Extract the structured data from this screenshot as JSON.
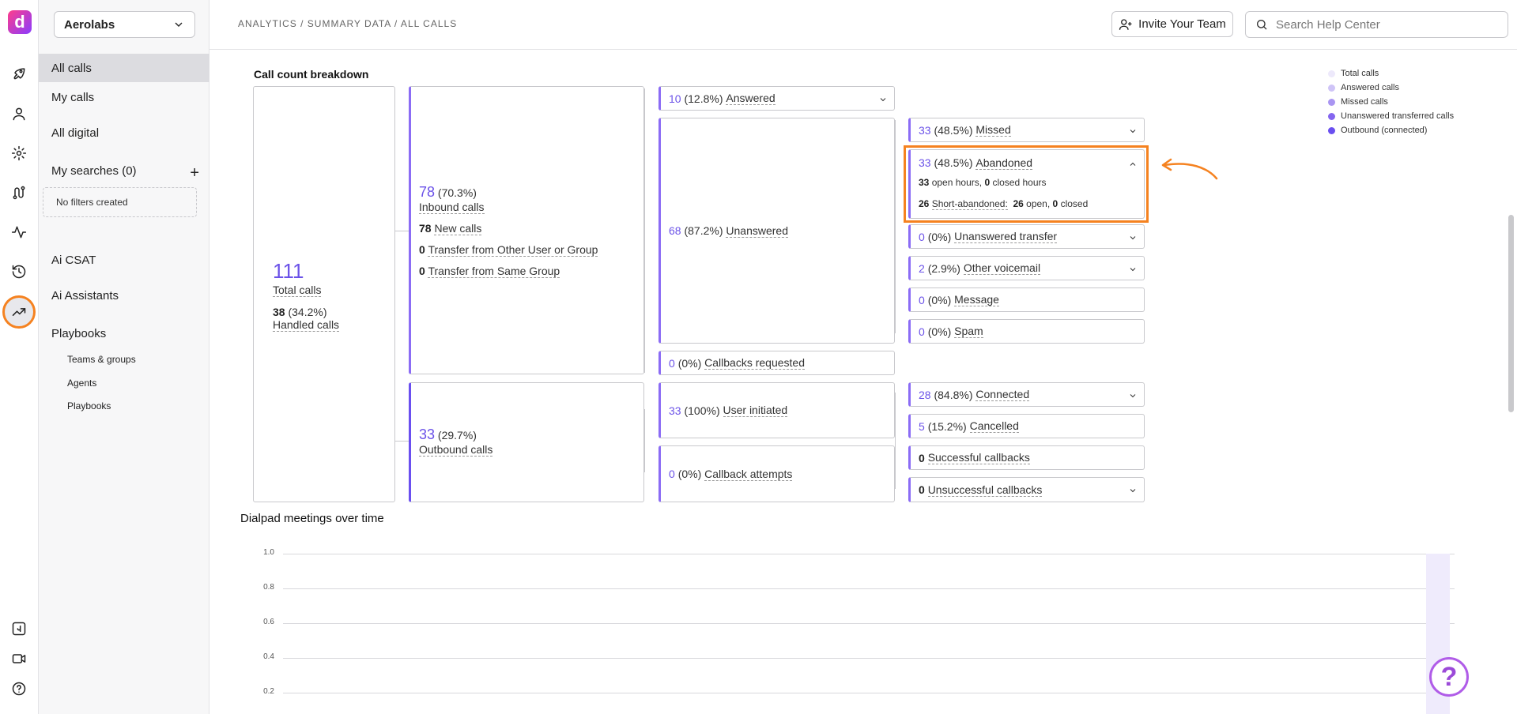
{
  "rail": {
    "logo_letter": "d",
    "icons": [
      "rocket-icon",
      "user-icon",
      "gear-icon",
      "route-icon",
      "activity-icon",
      "history-icon",
      "trending-up-icon",
      "dialpad-icon",
      "video-icon",
      "help-icon"
    ]
  },
  "nav": {
    "org": "Aerolabs",
    "items": [
      {
        "label": "All calls"
      },
      {
        "label": "My calls"
      },
      {
        "label": "All digital"
      },
      {
        "label": "My searches (0)"
      },
      {
        "label": "Ai CSAT"
      },
      {
        "label": "Ai Assistants"
      },
      {
        "label": "Playbooks"
      }
    ],
    "no_filters": "No filters created",
    "sub_items": [
      {
        "label": "Teams & groups"
      },
      {
        "label": "Agents"
      },
      {
        "label": "Playbooks"
      }
    ]
  },
  "header": {
    "breadcrumb": "ANALYTICS / SUMMARY DATA / ALL CALLS",
    "invite_label": "Invite Your Team",
    "search_placeholder": "Search Help Center"
  },
  "breakdown": {
    "title": "Call count breakdown",
    "total": {
      "value": "111",
      "label": "Total calls",
      "handled_value": "38",
      "handled_pct": "(34.2%)",
      "handled_label": "Handled calls"
    },
    "inbound": {
      "value": "78",
      "pct": "(70.3%)",
      "label": "Inbound calls",
      "new_value": "78",
      "new_label": "New calls",
      "other_value": "0",
      "other_label": "Transfer from Other User or Group",
      "same_value": "0",
      "same_label": "Transfer from Same Group"
    },
    "outbound": {
      "value": "33",
      "pct": "(29.7%)",
      "label": "Outbound calls"
    },
    "answered": {
      "value": "10",
      "pct": "(12.8%)",
      "label": "Answered"
    },
    "unanswered": {
      "value": "68",
      "pct": "(87.2%)",
      "label": "Unanswered"
    },
    "callbacks_requested": {
      "value": "0",
      "pct": "(0%)",
      "label": "Callbacks requested"
    },
    "user_initiated": {
      "value": "33",
      "pct": "(100%)",
      "label": "User initiated"
    },
    "callback_attempts": {
      "value": "0",
      "pct": "(0%)",
      "label": "Callback attempts"
    },
    "missed": {
      "value": "33",
      "pct": "(48.5%)",
      "label": "Missed"
    },
    "abandoned": {
      "value": "33",
      "pct": "(48.5%)",
      "label": "Abandoned",
      "open_hours_value": "33",
      "open_hours_label": "open hours,",
      "closed_hours_value": "0",
      "closed_hours_label": "closed hours",
      "short_value": "26",
      "short_label": "Short-abandoned:",
      "short_open_value": "26",
      "short_open_label": "open,",
      "short_closed_value": "0",
      "short_closed_label": "closed"
    },
    "unanswered_transfer": {
      "value": "0",
      "pct": "(0%)",
      "label": "Unanswered transfer"
    },
    "other_voicemail": {
      "value": "2",
      "pct": "(2.9%)",
      "label": "Other voicemail"
    },
    "message": {
      "value": "0",
      "pct": "(0%)",
      "label": "Message"
    },
    "spam": {
      "value": "0",
      "pct": "(0%)",
      "label": "Spam"
    },
    "connected": {
      "value": "28",
      "pct": "(84.8%)",
      "label": "Connected"
    },
    "cancelled": {
      "value": "5",
      "pct": "(15.2%)",
      "label": "Cancelled"
    },
    "successful_callbacks": {
      "value": "0",
      "label": "Successful callbacks"
    },
    "unsuccessful_callbacks": {
      "value": "0",
      "label": "Unsuccessful callbacks"
    }
  },
  "legend": {
    "items": [
      {
        "label": "Total calls",
        "color": "#ede9fb"
      },
      {
        "label": "Answered calls",
        "color": "#cfc4f7"
      },
      {
        "label": "Missed calls",
        "color": "#a995f2"
      },
      {
        "label": "Unanswered transferred calls",
        "color": "#8466ef"
      },
      {
        "label": "Outbound (connected)",
        "color": "#6a4ff0"
      }
    ]
  },
  "meetings": {
    "title": "Dialpad meetings over time",
    "ticks": [
      "1.0",
      "0.8",
      "0.6",
      "0.4",
      "0.2"
    ]
  },
  "colors": {
    "accent": "#6b52e8",
    "highlight": "#f58220"
  }
}
